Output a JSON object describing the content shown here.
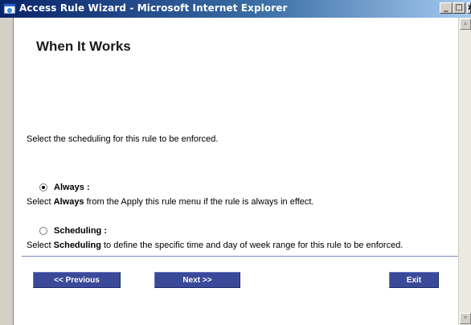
{
  "window": {
    "title": "Access Rule Wizard - Microsoft Internet Explorer",
    "min_glyph": "_",
    "max_glyph": "□",
    "close_glyph": "x"
  },
  "page": {
    "title": "When It Works",
    "instruction": "Select the scheduling for this rule to be enforced."
  },
  "options": {
    "always": {
      "label": "Always :",
      "selected": true,
      "desc_prefix": "Select ",
      "desc_bold": "Always",
      "desc_suffix": " from the Apply this rule menu if the rule is always in effect."
    },
    "scheduling": {
      "label": "Scheduling :",
      "selected": false,
      "desc_prefix": "Select ",
      "desc_bold": "Scheduling",
      "desc_suffix": " to define the specific time and day of week range for this rule to be enforced."
    }
  },
  "buttons": {
    "previous": "<< Previous",
    "next": "Next >>",
    "exit": "Exit"
  },
  "colors": {
    "wizard_button": "#3b4a98",
    "divider": "#7a86c8"
  }
}
